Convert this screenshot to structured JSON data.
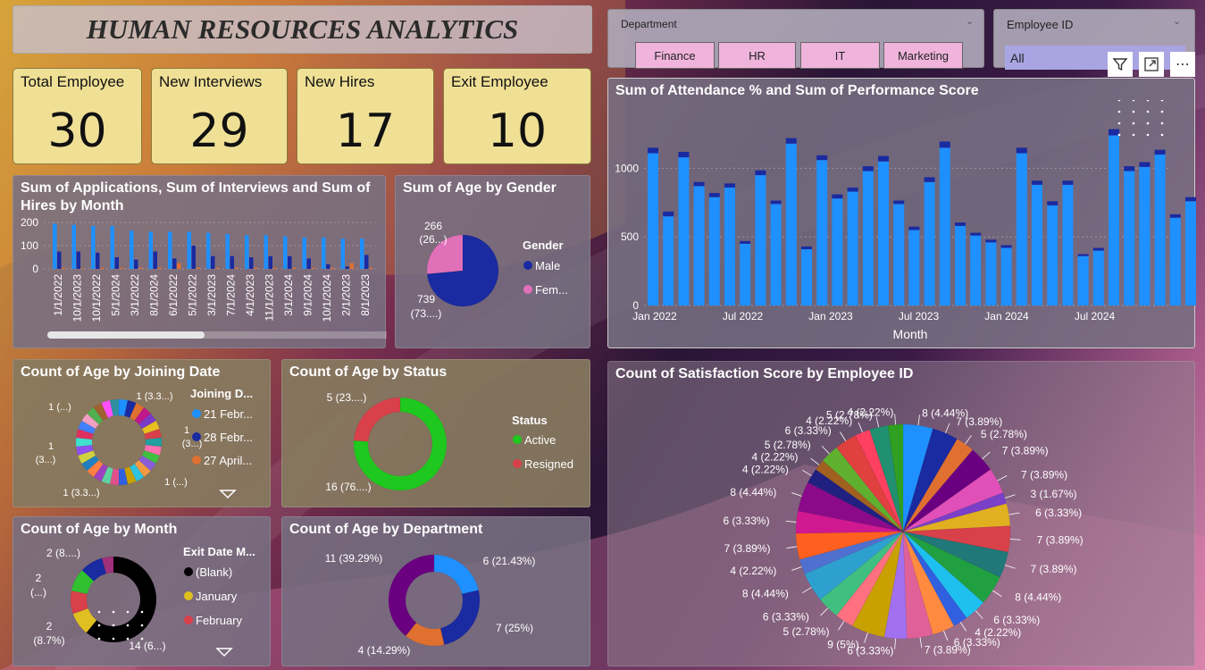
{
  "title": "HUMAN RESOURCES ANALYTICS",
  "kpis": [
    {
      "label": "Total Employee",
      "value": "30"
    },
    {
      "label": "New Interviews",
      "value": "29"
    },
    {
      "label": "New Hires",
      "value": "17"
    },
    {
      "label": "Exit Employee",
      "value": "10"
    }
  ],
  "department_slicer": {
    "title": "Department",
    "options": [
      "Finance",
      "HR",
      "IT",
      "Marketing"
    ]
  },
  "employee_slicer": {
    "title": "Employee ID",
    "value": "All"
  },
  "colors": {
    "kpi_bg": "#efe096",
    "chip_bg": "#f0b4dc",
    "bar_blue": "#1e90ff",
    "bar_navy": "#1a2aa0",
    "bar_orange": "#e07030",
    "male": "#1a2aa0",
    "female": "#e070b8",
    "active": "#1ec81e",
    "resigned": "#d8404a"
  },
  "chart_data": [
    {
      "id": "applications",
      "type": "bar",
      "title": "Sum of Applications, Sum of Interviews and Sum of Hires by Month",
      "categories": [
        "1/1/2022",
        "10/1/2023",
        "10/1/2022",
        "5/1/2024",
        "3/1/2022",
        "8/1/2024",
        "6/1/2022",
        "5/1/2022",
        "3/1/2023",
        "7/1/2024",
        "4/1/2023",
        "11/1/2023",
        "3/1/2024",
        "9/1/2024",
        "10/1/2024",
        "2/1/2023",
        "8/1/2023"
      ],
      "series": [
        {
          "values": [
            195,
            190,
            185,
            185,
            165,
            160,
            160,
            160,
            155,
            150,
            145,
            145,
            140,
            135,
            135,
            130,
            130
          ]
        },
        {
          "values": [
            75,
            75,
            70,
            50,
            40,
            75,
            45,
            100,
            55,
            55,
            50,
            55,
            55,
            45,
            20,
            10,
            60
          ]
        },
        {
          "values": [
            5,
            3,
            5,
            5,
            5,
            5,
            25,
            5,
            5,
            5,
            5,
            5,
            5,
            5,
            5,
            25,
            5
          ]
        }
      ],
      "yticks": [
        "200",
        "100",
        "0"
      ],
      "ylim": [
        0,
        200
      ]
    },
    {
      "id": "age_gender",
      "type": "pie",
      "title": "Sum of Age by Gender",
      "legend_title": "Gender",
      "labels": [
        "Male",
        "Fem..."
      ],
      "values": [
        739,
        266
      ],
      "data_labels": [
        [
          "739",
          "(73....)"
        ],
        [
          "266",
          "(26...)"
        ]
      ]
    },
    {
      "id": "attendance",
      "type": "bar",
      "title": "Sum of Attendance % and Sum of Performance Score",
      "xlabel": "Month",
      "xticks": [
        "Jan 2022",
        "Jul 2022",
        "Jan 2023",
        "Jul 2023",
        "Jan 2024",
        "Jul 2024"
      ],
      "yticks": [
        "1000",
        "500",
        "0"
      ],
      "ylim": [
        0,
        1250
      ],
      "series": [
        {
          "values": [
            1110,
            650,
            1080,
            870,
            790,
            860,
            450,
            950,
            740,
            1180,
            410,
            1060,
            780,
            830,
            980,
            1050,
            740,
            550,
            900,
            1150,
            580,
            510,
            460,
            420,
            1110,
            880,
            730,
            880,
            360,
            400,
            1240,
            980,
            1010,
            1100,
            640,
            760
          ]
        },
        {
          "values": [
            40,
            35,
            40,
            30,
            30,
            30,
            20,
            35,
            25,
            40,
            20,
            35,
            30,
            30,
            35,
            40,
            25,
            25,
            35,
            45,
            25,
            20,
            20,
            20,
            40,
            30,
            30,
            30,
            15,
            20,
            45,
            35,
            35,
            35,
            25,
            30
          ]
        }
      ]
    },
    {
      "id": "joining",
      "type": "pie",
      "title": "Count of Age by Joining Date",
      "legend_title": "Joining D...",
      "legend": [
        "21 Febr...",
        "28 Febr...",
        "27 April..."
      ],
      "data_labels": [
        "1 (3.3...)",
        "1 (...)",
        "1",
        "(3...)",
        "1",
        "(3...)",
        "1 (3.3...)",
        "1 (...)"
      ],
      "values": [
        1,
        1,
        1,
        1,
        1,
        1,
        1,
        1,
        1,
        1,
        1,
        1,
        1,
        1,
        1,
        1,
        1,
        1,
        1,
        1,
        1,
        1,
        1,
        1,
        1,
        1,
        1,
        1,
        1,
        1
      ]
    },
    {
      "id": "status",
      "type": "pie",
      "title": "Count of Age by Status",
      "legend_title": "Status",
      "labels": [
        "Active",
        "Resigned"
      ],
      "values": [
        16,
        5
      ],
      "data_labels": [
        "16 (76....)",
        "5 (23....)"
      ]
    },
    {
      "id": "satisfaction",
      "type": "pie",
      "title": "Count of Satisfaction Score by Employee ID",
      "values": [
        8,
        7,
        5,
        7,
        7,
        3,
        6,
        7,
        7,
        8,
        6,
        4,
        6,
        7,
        6,
        9,
        5,
        6,
        8,
        4,
        7,
        6,
        8,
        4,
        3,
        5,
        6,
        4,
        5,
        4
      ],
      "data_labels": [
        "8 (4.44%)",
        "7 (3.89%)",
        "5 (2.78%)",
        "7 (3.89%)",
        "7 (3.89%)",
        "3 (1.67%)",
        "6 (3.33%)",
        "7 (3.89%)",
        "7 (3.89%)",
        "8 (4.44%)",
        "6 (3.33%)",
        "4 (2.22%)",
        "6 (3.33%)",
        "7 (3.89%)",
        "6 (3.33%)",
        "9 (5%)",
        "5 (2.78%)",
        "6 (3.33%)",
        "8 (4.44%)",
        "4 (2.22%)",
        "7 (3.89%)",
        "6 (3.33%)",
        "8 (4.44%)",
        "4 (2.22%)",
        "4 (2.22%)",
        "5 (2.78%)",
        "6 (3.33%)",
        "4 (2.22%)",
        "5 (2.78%)",
        "4 (2.22%)"
      ]
    },
    {
      "id": "month",
      "type": "pie",
      "title": "Count of Age by Month",
      "legend_title": "Exit Date M...",
      "legend": [
        "(Blank)",
        "January",
        "February"
      ],
      "data_labels": [
        "2 (8....)",
        "2",
        "(...)",
        "2",
        "(8.7%)",
        "14 (6...)"
      ],
      "values": [
        14,
        2,
        2,
        2,
        2,
        1
      ]
    },
    {
      "id": "department",
      "type": "pie",
      "title": "Count of Age by Department",
      "values": [
        6,
        7,
        4,
        11
      ],
      "data_labels": [
        "6 (21.43%)",
        "7 (25%)",
        "4 (14.29%)",
        "11 (39.29%)"
      ]
    }
  ]
}
